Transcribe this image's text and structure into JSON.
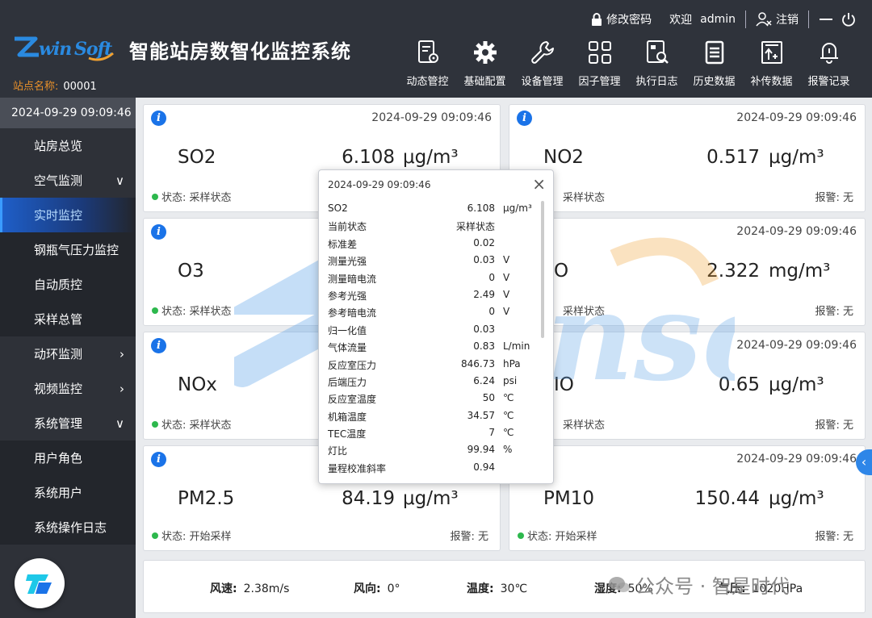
{
  "header": {
    "logo_text": "ZwinSoft",
    "title": "智能站房数智化监控系统",
    "station_label": "站点名称:",
    "station_value": "00001",
    "change_password": "修改密码",
    "welcome": "欢迎",
    "user": "admin",
    "logout": "注销",
    "toolbar": [
      {
        "label": "动态管控",
        "icon": "doc-gear-icon"
      },
      {
        "label": "基础配置",
        "icon": "gear-icon"
      },
      {
        "label": "设备管理",
        "icon": "wrench-icon"
      },
      {
        "label": "因子管理",
        "icon": "grid-icon"
      },
      {
        "label": "执行日志",
        "icon": "log-search-icon"
      },
      {
        "label": "历史数据",
        "icon": "document-icon"
      },
      {
        "label": "补传数据",
        "icon": "upload-icon"
      },
      {
        "label": "报警记录",
        "icon": "bell-icon"
      }
    ]
  },
  "sidebar": {
    "time": "2024-09-29 09:09:46",
    "items": [
      {
        "label": "站房总览",
        "chevron": "",
        "level": "top"
      },
      {
        "label": "空气监测",
        "chevron": "∨",
        "level": "top"
      },
      {
        "label": "实时监控",
        "chevron": "",
        "level": "sub",
        "active": true
      },
      {
        "label": "钢瓶气压力监控",
        "chevron": "",
        "level": "sub"
      },
      {
        "label": "自动质控",
        "chevron": "",
        "level": "sub"
      },
      {
        "label": "采样总管",
        "chevron": "",
        "level": "sub"
      },
      {
        "label": "动环监测",
        "chevron": "›",
        "level": "top"
      },
      {
        "label": "视频监控",
        "chevron": "›",
        "level": "top"
      },
      {
        "label": "系统管理",
        "chevron": "∨",
        "level": "top"
      },
      {
        "label": "用户角色",
        "chevron": "",
        "level": "sub"
      },
      {
        "label": "系统用户",
        "chevron": "",
        "level": "sub"
      },
      {
        "label": "系统操作日志",
        "chevron": "",
        "level": "sub"
      }
    ]
  },
  "cards": [
    {
      "ts": "2024-09-29 09:09:46",
      "name": "SO2",
      "value": "6.108",
      "unit": "μg/m³",
      "status": "状态: 采样状态",
      "alarm": ""
    },
    {
      "ts": "2024-09-29 09:09:46",
      "name": "NO2",
      "value": "0.517",
      "unit": "μg/m³",
      "status": "采样状态",
      "alarm": "报警: 无"
    },
    {
      "ts": "",
      "name": "O3",
      "value": "",
      "unit": "",
      "status": "状态: 采样状态",
      "alarm": ""
    },
    {
      "ts": "2024-09-29 09:09:46",
      "name": "O",
      "value": "2.322",
      "unit": "mg/m³",
      "status": "采样状态",
      "alarm": "报警: 无"
    },
    {
      "ts": "",
      "name": "NOx",
      "value": "",
      "unit": "",
      "status": "状态: 采样状态",
      "alarm": ""
    },
    {
      "ts": "2024-09-29 09:09:46",
      "name": "IO",
      "value": "0.65",
      "unit": "μg/m³",
      "status": "采样状态",
      "alarm": "报警: 无"
    },
    {
      "ts": "",
      "name": "PM2.5",
      "value": "84.19",
      "unit": "μg/m³",
      "status": "状态: 开始采样",
      "alarm": "报警: 无"
    },
    {
      "ts": "2024-09-29 09:09:46",
      "name": "PM10",
      "value": "150.44",
      "unit": "μg/m³",
      "status": "状态: 开始采样",
      "alarm": "报警: 无"
    }
  ],
  "popup": {
    "ts": "2024-09-29 09:09:46",
    "close": "×",
    "rows": [
      {
        "label": "SO2",
        "value": "6.108",
        "unit": "μg/m³"
      },
      {
        "label": "当前状态",
        "value": "采样状态",
        "unit": ""
      },
      {
        "label": "标准差",
        "value": "0.02",
        "unit": ""
      },
      {
        "label": "测量光强",
        "value": "0.03",
        "unit": "V"
      },
      {
        "label": "测量暗电流",
        "value": "0",
        "unit": "V"
      },
      {
        "label": "参考光强",
        "value": "2.49",
        "unit": "V"
      },
      {
        "label": "参考暗电流",
        "value": "0",
        "unit": "V"
      },
      {
        "label": "归一化值",
        "value": "0.03",
        "unit": ""
      },
      {
        "label": "气体流量",
        "value": "0.83",
        "unit": "L/min"
      },
      {
        "label": "反应室压力",
        "value": "846.73",
        "unit": "hPa"
      },
      {
        "label": "后端压力",
        "value": "6.24",
        "unit": "psi"
      },
      {
        "label": "反应室温度",
        "value": "50",
        "unit": "℃"
      },
      {
        "label": "机箱温度",
        "value": "34.57",
        "unit": "℃"
      },
      {
        "label": "TEC温度",
        "value": "7",
        "unit": "℃"
      },
      {
        "label": "灯比",
        "value": "99.94",
        "unit": "%"
      },
      {
        "label": "量程校准斜率",
        "value": "0.94",
        "unit": ""
      }
    ]
  },
  "footer": {
    "wind_speed_label": "风速:",
    "wind_speed": "2.38m/s",
    "wind_dir_label": "风向:",
    "wind_dir": "0°",
    "temp_label": "温度:",
    "temp": "30℃",
    "humidity_label": "湿度:",
    "humidity": "50%",
    "pressure_label": "气压:",
    "pressure": "1020HPa",
    "wechat_mark": "公众号 · 智是时代"
  },
  "colors": {
    "accent": "#1a73e8",
    "header_bg": "#2f333b",
    "sidebar_bg": "#2e3138",
    "status_dot": "#2db84d",
    "station_label": "#e8902a"
  }
}
